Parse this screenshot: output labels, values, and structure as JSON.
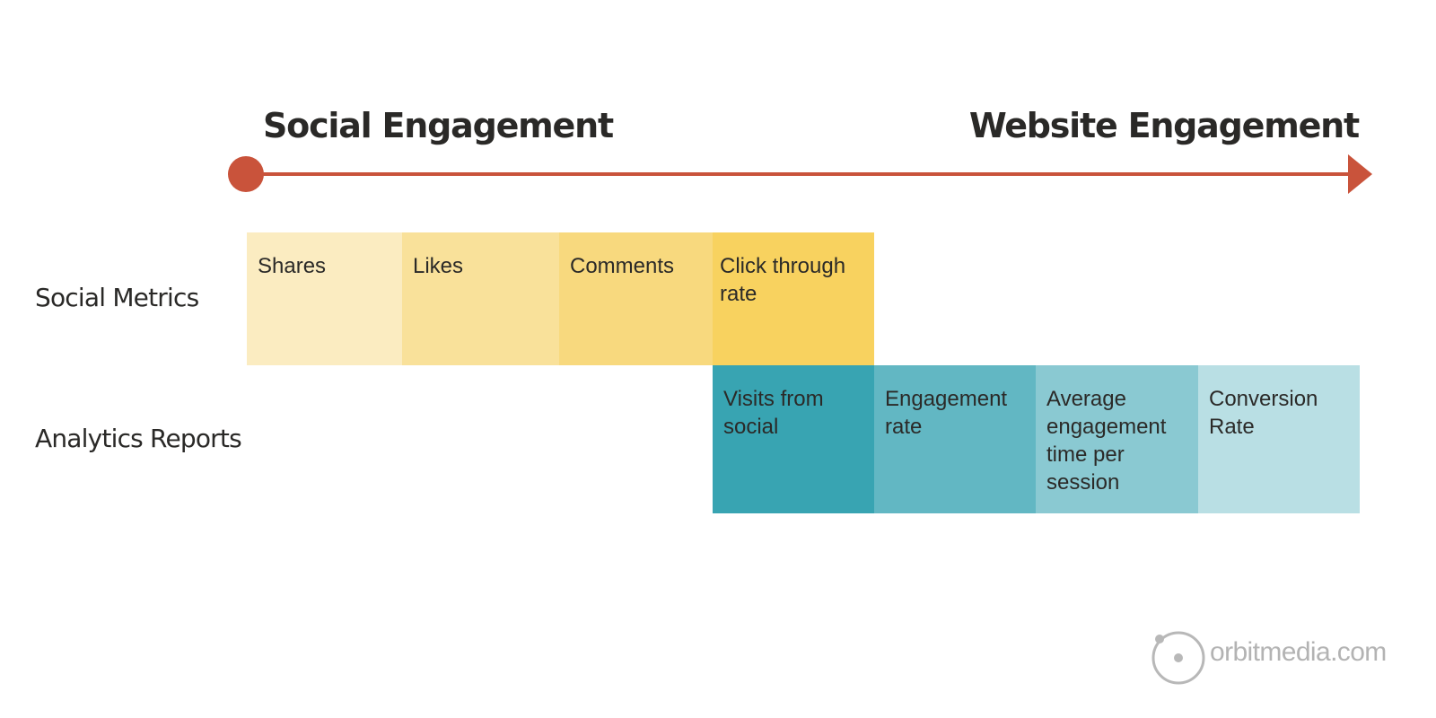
{
  "header": {
    "left_title": "Social Engagement",
    "right_title": "Website Engagement",
    "accent_color": "#c9533b"
  },
  "rows": {
    "social_metrics": {
      "label": "Social Metrics",
      "cells": [
        {
          "text": "Shares",
          "color": "#fbecc1"
        },
        {
          "text": "Likes",
          "color": "#f9e19a"
        },
        {
          "text": "Comments",
          "color": "#f8d97e"
        },
        {
          "text": "Click through\nrate",
          "color": "#f8d25f"
        }
      ]
    },
    "analytics_reports": {
      "label": "Analytics Reports",
      "cells": [
        {
          "text": "Visits from\nsocial",
          "color": "#38a4b2"
        },
        {
          "text": "Engagement\nrate",
          "color": "#62b7c3"
        },
        {
          "text": "Average\nengagement\ntime per\nsession",
          "color": "#8ac9d2"
        },
        {
          "text": "Conversion\nRate",
          "color": "#b9dfe4"
        }
      ]
    }
  },
  "logo": {
    "text": "orbitmedia.com",
    "icon": "orbit-icon",
    "color": "#b3b3b3"
  }
}
